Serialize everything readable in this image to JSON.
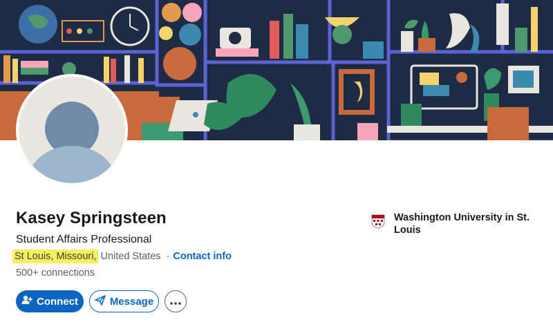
{
  "profile": {
    "name": "Kasey Springsteen",
    "headline": "Student Affairs Professional",
    "location_highlight": "St Louis, Missouri,",
    "location_rest": "United States",
    "separator": "·",
    "contact_label": "Contact info",
    "connections": "500+ connections"
  },
  "education": {
    "school": "Washington University in St. Louis",
    "logo_icon": "university-shield-icon"
  },
  "actions": {
    "connect_label": "Connect",
    "message_label": "Message",
    "more_icon": "more-horizontal-icon"
  },
  "colors": {
    "brand": "#0a66c2",
    "highlight": "#f5ef5e",
    "banner_bg": "#1f2a44"
  }
}
